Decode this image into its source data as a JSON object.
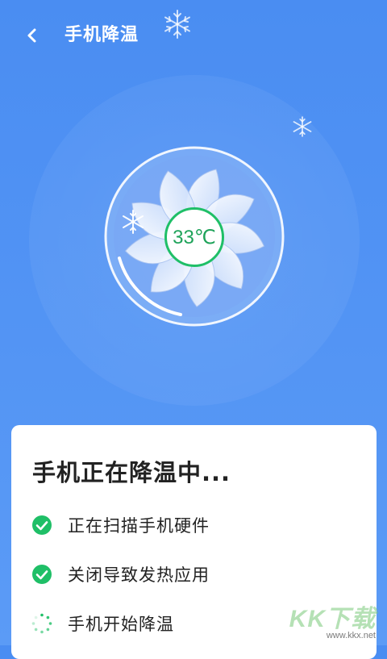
{
  "header": {
    "title": "手机降温",
    "back_icon": "chevron-left-icon"
  },
  "fan": {
    "temperature": "33℃",
    "accent_color": "#1fbf67"
  },
  "card": {
    "title": "手机正在降温中...",
    "steps": [
      {
        "label": "正在扫描手机硬件",
        "status": "done",
        "icon": "check-circle-icon"
      },
      {
        "label": "关闭导致发热应用",
        "status": "done",
        "icon": "check-circle-icon"
      },
      {
        "label": "手机开始降温",
        "status": "in-progress",
        "icon": "spinner-icon"
      }
    ]
  },
  "watermark": {
    "main": "KK下载",
    "sub": "www.kkx.net"
  },
  "colors": {
    "background": "#4a8df2",
    "success": "#1fbf67",
    "text": "#222222"
  }
}
